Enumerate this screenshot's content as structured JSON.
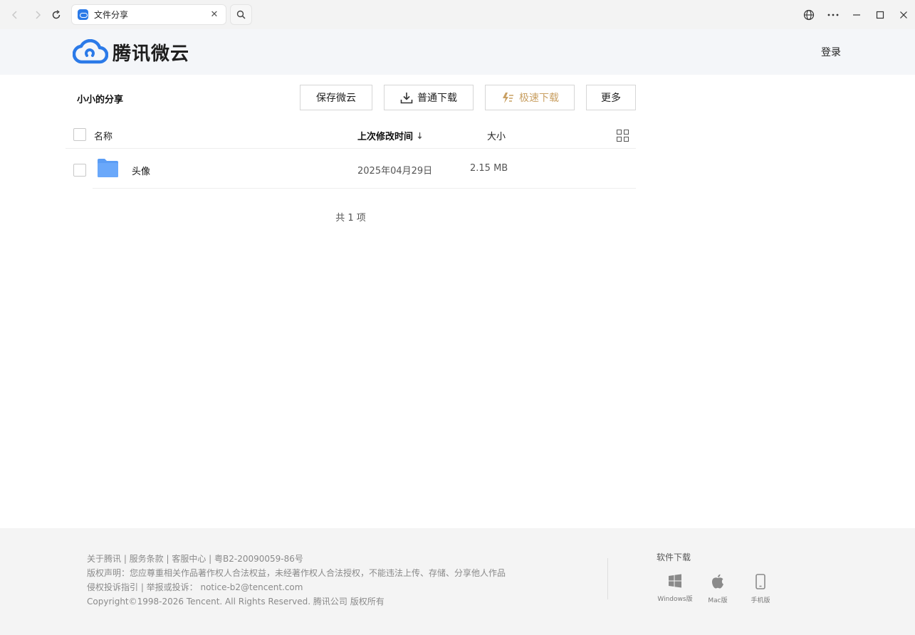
{
  "browser": {
    "tab_title": "文件分享",
    "close_glyph": "✕"
  },
  "site": {
    "logo_text": "腾讯微云",
    "login_label": "登录",
    "brand_color": "#2b7ae8"
  },
  "share": {
    "title": "小小的分享",
    "buttons": {
      "save": "保存微云",
      "download": "普通下载",
      "fast_download": "极速下载",
      "more": "更多"
    }
  },
  "table": {
    "headers": {
      "name": "名称",
      "modified": "上次修改时间",
      "size": "大小"
    },
    "rows": [
      {
        "name": "头像",
        "modified": "2025年04月29日",
        "size": "2.15 MB",
        "type": "folder-icon"
      }
    ],
    "count_text": "共 1 项"
  },
  "footer": {
    "links_line": "关于腾讯 | 服务条款 | 客服中心 | 粤B2-20090059-86号",
    "copyright_notice": "版权声明：您应尊重相关作品著作权人合法权益，未经著作权人合法授权，不能违法上传、存储、分享他人作品",
    "report_line": "侵权投诉指引 | 举报或投诉： notice-b2@tencent.com",
    "copyright_line": "Copyright©1998-2026 Tencent. All Rights Reserved. 腾讯公司 版权所有",
    "download_title": "软件下载",
    "downloads": [
      {
        "label": "Windows版",
        "icon": "windows-icon"
      },
      {
        "label": "Mac版",
        "icon": "apple-icon"
      },
      {
        "label": "手机版",
        "icon": "phone-icon"
      }
    ]
  }
}
